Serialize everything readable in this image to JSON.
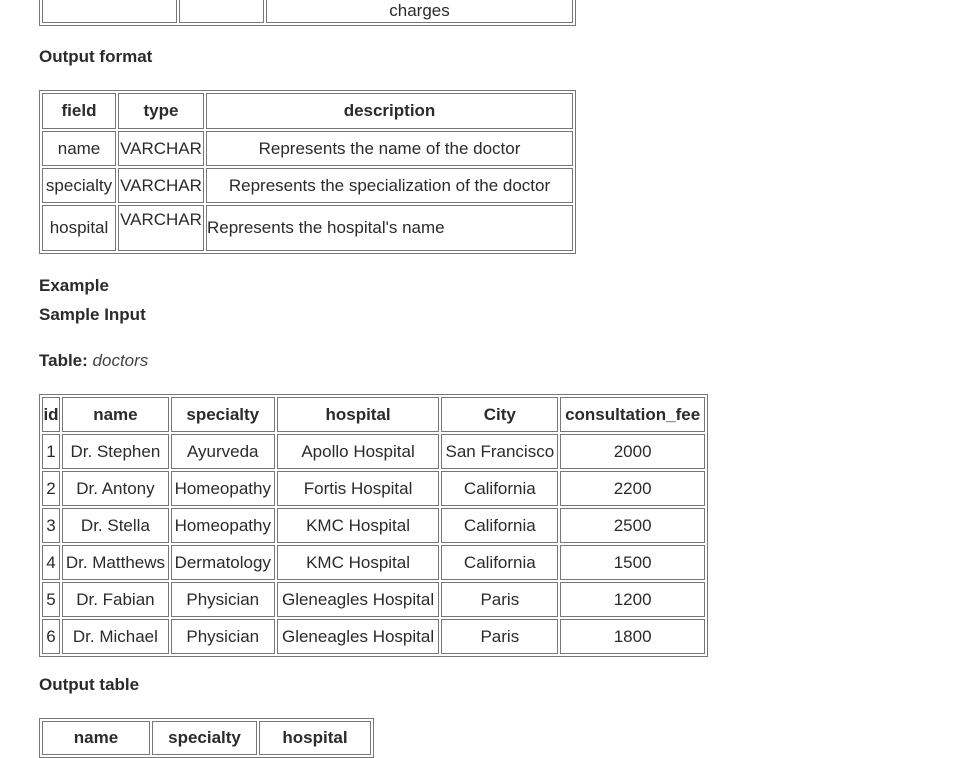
{
  "top_fragment": {
    "cell_text": "charges"
  },
  "output_format": {
    "heading": "Output format",
    "headers": [
      "field",
      "type",
      "description"
    ],
    "rows": [
      [
        "name",
        "VARCHAR",
        "Represents the name of the doctor"
      ],
      [
        "specialty",
        "VARCHAR",
        "Represents the specialization of the doctor"
      ],
      [
        "hospital",
        "VARCHAR",
        "Represents the hospital's name"
      ]
    ]
  },
  "example": {
    "heading": "Example",
    "sample_input_heading": "Sample Input",
    "table_label": "Table:",
    "table_name": "doctors"
  },
  "doctors_table": {
    "headers": [
      "id",
      "name",
      "specialty",
      "hospital",
      "City",
      "consultation_fee"
    ],
    "rows": [
      [
        "1",
        "Dr. Stephen",
        "Ayurveda",
        "Apollo Hospital",
        "San Francisco",
        "2000"
      ],
      [
        "2",
        "Dr. Antony",
        "Homeopathy",
        "Fortis Hospital",
        "California",
        "2200"
      ],
      [
        "3",
        "Dr. Stella",
        "Homeopathy",
        "KMC Hospital",
        "California",
        "2500"
      ],
      [
        "4",
        "Dr. Matthews",
        "Dermatology",
        "KMC Hospital",
        "California",
        "1500"
      ],
      [
        "5",
        "Dr. Fabian",
        "Physician",
        "Gleneagles Hospital",
        "Paris",
        "1200"
      ],
      [
        "6",
        "Dr. Michael",
        "Physician",
        "Gleneagles Hospital",
        "Paris",
        "1800"
      ]
    ]
  },
  "output_table": {
    "heading": "Output table",
    "headers": [
      "name",
      "specialty",
      "hospital"
    ]
  }
}
